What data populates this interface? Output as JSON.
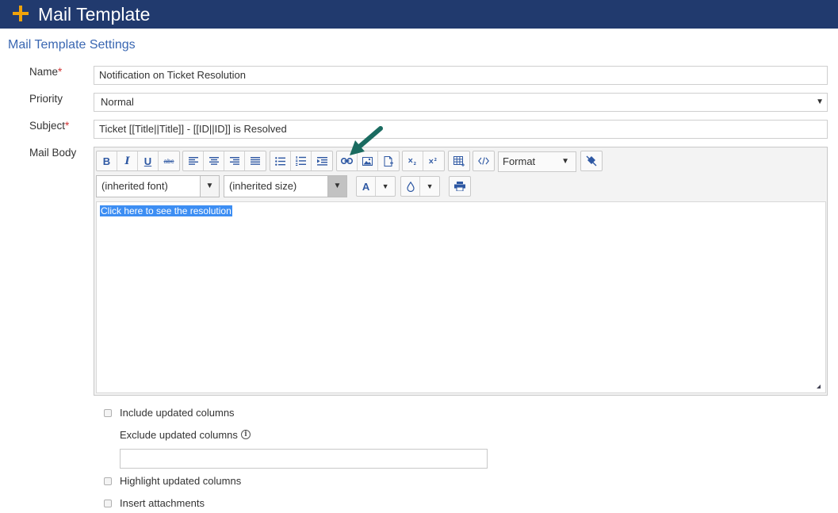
{
  "header": {
    "title": "Mail Template",
    "icon": "plus-icon",
    "accent": "#f0a30a",
    "bg": "#213a6e"
  },
  "section": {
    "title": "Mail Template Settings"
  },
  "form": {
    "name": {
      "label": "Name",
      "required_mark": "*",
      "value": "Notification on Ticket Resolution"
    },
    "priority": {
      "label": "Priority",
      "value": "Normal",
      "arrow": "▼"
    },
    "subject": {
      "label": "Subject",
      "required_mark": "*",
      "value": "Ticket [[Title||Title]] - [[ID||ID]] is Resolved"
    },
    "mail_body": {
      "label": "Mail Body"
    }
  },
  "editor": {
    "toolbar": {
      "bold": "B",
      "italic": "I",
      "underline": "U",
      "strike": "abc",
      "format_label": "Format",
      "format_arrow": "▼"
    },
    "font_family": "(inherited font)",
    "font_size": "(inherited size)",
    "font_color_label": "A",
    "dd_arrow": "▼",
    "content_link_text": "Click here to see the resolution"
  },
  "options": {
    "include_updated": "Include updated columns",
    "exclude_updated": "Exclude updated columns",
    "info_glyph": "i",
    "highlight_updated": "Highlight updated columns",
    "insert_attachments": "Insert attachments"
  }
}
